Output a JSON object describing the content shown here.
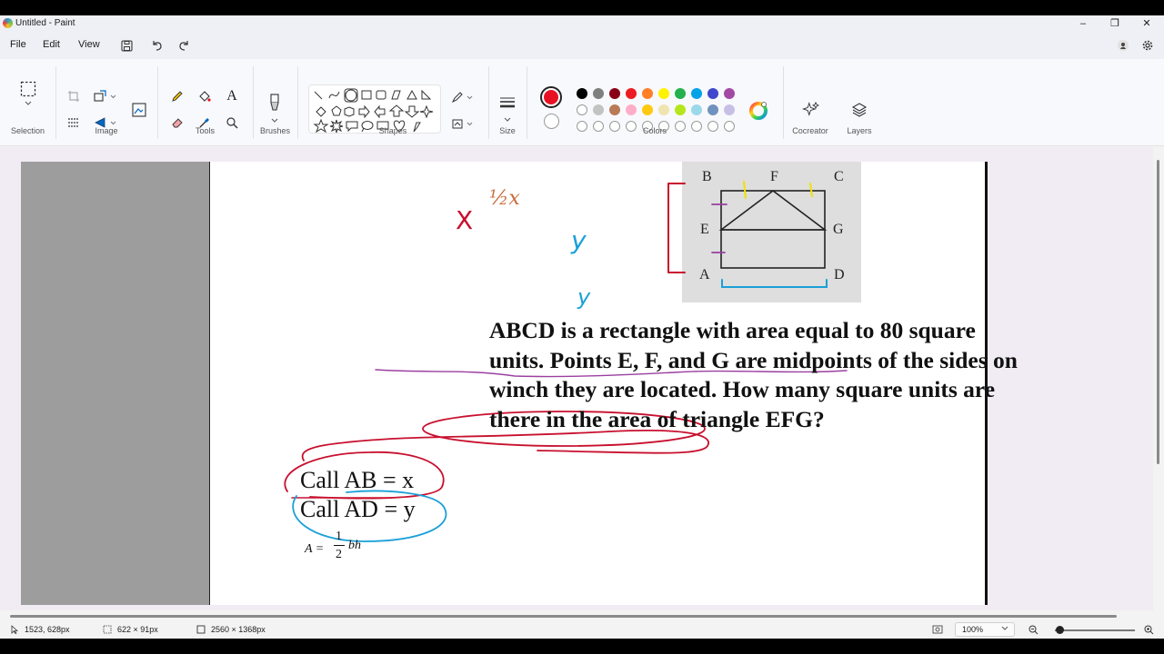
{
  "window": {
    "title": "Untitled - Paint"
  },
  "menu": {
    "file": "File",
    "edit": "Edit",
    "view": "View"
  },
  "ribbon": {
    "groups": {
      "selection": "Selection",
      "image": "Image",
      "tools": "Tools",
      "brushes": "Brushes",
      "shapes": "Shapes",
      "size": "Size",
      "colors": "Colors",
      "cocreator": "Cocreator",
      "layers": "Layers"
    },
    "colors": {
      "primary": "#e81123",
      "secondary": "#ffffff",
      "row1": [
        "#000000",
        "#7f7f7f",
        "#880015",
        "#ed1c24",
        "#ff7f27",
        "#fff200",
        "#22b14c",
        "#00a2e8",
        "#3f48cc",
        "#a349a4"
      ],
      "row2": [
        "#ffffff",
        "#c3c3c3",
        "#b97a57",
        "#ffaec9",
        "#ffc90e",
        "#efe4b0",
        "#b5e61d",
        "#99d9ea",
        "#7092be",
        "#c8bfe7"
      ],
      "row3_empty_count": 10
    }
  },
  "canvas": {
    "figure_labels": {
      "b": "B",
      "f": "F",
      "c": "C",
      "e": "E",
      "g": "G",
      "a": "A",
      "d": "D"
    },
    "annotations": {
      "x": "X",
      "half_x": "½x",
      "y_inside": "y",
      "y_below": "y"
    },
    "problem_lines": [
      "ABCD is a rectangle with area equal to 80 square",
      "units. Points E, F, and G are midpoints of the sides on",
      "winch they are located. How many square units are",
      "there in the area of triangle EFG?"
    ],
    "call_ab": "Call AB = x",
    "call_ad": "Call AD = y",
    "formula": {
      "lhs": "A =",
      "numerator": "1",
      "denominator": "2",
      "rhs": "bh"
    }
  },
  "status": {
    "cursor": "1523, 628px",
    "selection": "622 × 91px",
    "canvas_size": "2560 × 1368px",
    "zoom": "100%"
  }
}
